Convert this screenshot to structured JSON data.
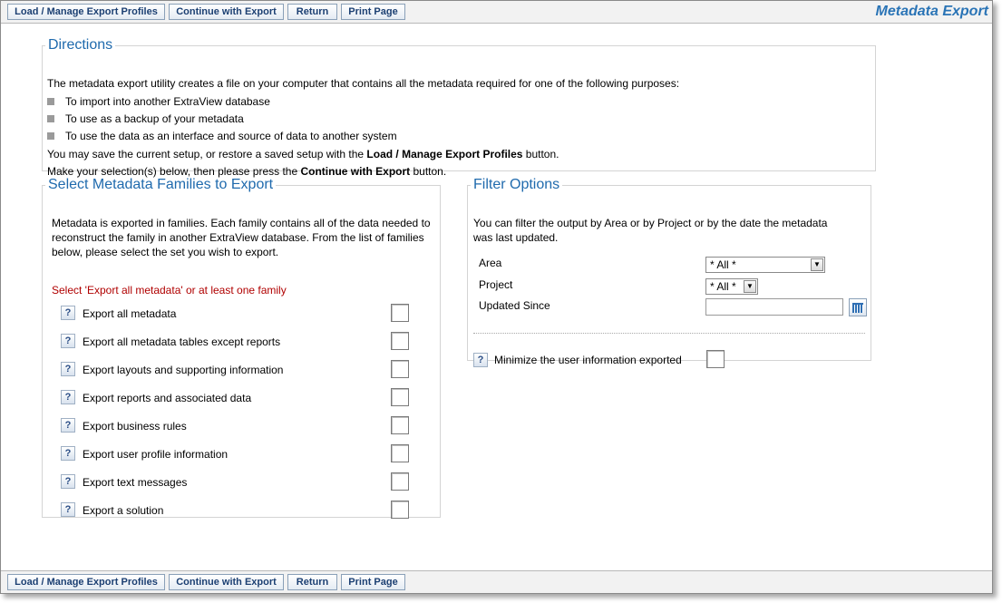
{
  "toolbar": {
    "buttons": [
      "Load / Manage Export Profiles",
      "Continue with Export",
      "Return",
      "Print Page"
    ],
    "title": "Metadata Export"
  },
  "directions": {
    "legend": "Directions",
    "intro": "The metadata export utility creates a file on your computer that contains all the metadata required for one of the following purposes:",
    "bullets": [
      "To import into another ExtraView database",
      "To use as a backup of your metadata",
      "To use the data as an interface and source of data to another system"
    ],
    "line1_pre": "You may save the current setup, or restore a saved setup with the ",
    "line1_bold": "Load / Manage Export Profiles",
    "line1_post": " button.",
    "line2_pre": "Make your selection(s) below, then please press the ",
    "line2_bold": "Continue with Export",
    "line2_post": " button."
  },
  "families": {
    "legend": "Select Metadata Families to Export",
    "description": "Metadata is exported in families. Each family contains all of the data needed to reconstruct the family in another ExtraView database. From the list of families below, please select the set you wish to export.",
    "warning": "Select 'Export all metadata' or at least one family",
    "help_glyph": "?",
    "items": [
      "Export all metadata",
      "Export all metadata tables except reports",
      "Export layouts and supporting information",
      "Export reports and associated data",
      "Export business rules",
      "Export user profile information",
      "Export text messages",
      "Export a solution"
    ]
  },
  "filter": {
    "legend": "Filter Options",
    "description": "You can filter the output by Area or by Project or by the date the metadata was last updated.",
    "area_label": "Area",
    "area_value": "* All *",
    "project_label": "Project",
    "project_value": "* All *",
    "updated_label": "Updated Since",
    "updated_value": "",
    "minimize_label": "Minimize the user information exported",
    "help_glyph": "?",
    "dropdown_glyph": "▼"
  }
}
